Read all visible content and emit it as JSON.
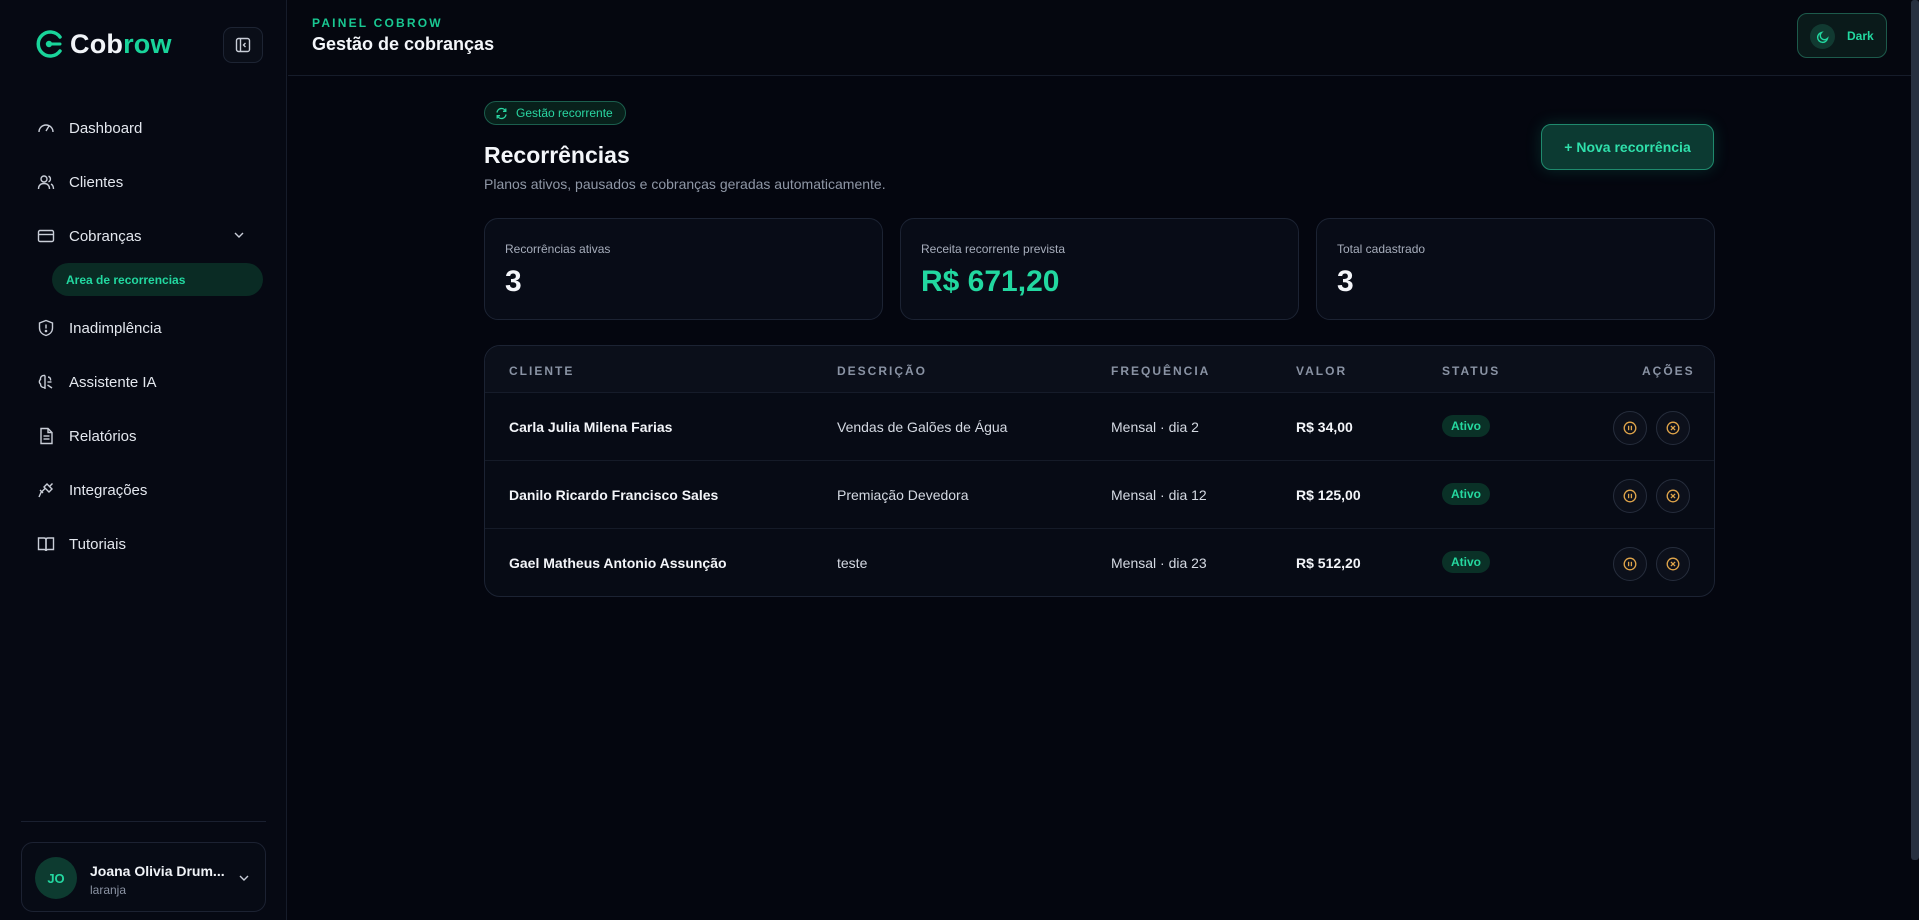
{
  "brand": {
    "name_part1": "Cob",
    "name_part2": "row",
    "accent": "#19d49a"
  },
  "sidebar": {
    "items": [
      {
        "label": "Dashboard",
        "icon": "gauge-icon"
      },
      {
        "label": "Clientes",
        "icon": "users-icon"
      },
      {
        "label": "Cobranças",
        "icon": "credit-card-icon",
        "expanded": true
      },
      {
        "label": "Inadimplência",
        "icon": "shield-alert-icon"
      },
      {
        "label": "Assistente IA",
        "icon": "brain-icon"
      },
      {
        "label": "Relatórios",
        "icon": "file-text-icon"
      },
      {
        "label": "Integrações",
        "icon": "plug-icon"
      },
      {
        "label": "Tutoriais",
        "icon": "book-open-icon"
      }
    ],
    "sub_item": "Area de recorrencias",
    "user": {
      "initials": "JO",
      "name": "Joana Olivia Drum...",
      "subtitle": "laranja"
    }
  },
  "header": {
    "kicker": "PAINEL COBROW",
    "title": "Gestão de cobranças",
    "theme_label": "Dark"
  },
  "main": {
    "pill": "Gestão recorrente",
    "title": "Recorrências",
    "subtitle": "Planos ativos, pausados e cobranças geradas automaticamente.",
    "new_button": "+ Nova recorrência",
    "stats": [
      {
        "label": "Recorrências ativas",
        "value": "3"
      },
      {
        "label": "Receita recorrente prevista",
        "value": "R$ 671,20"
      },
      {
        "label": "Total cadastrado",
        "value": "3"
      }
    ],
    "table": {
      "columns": [
        "CLIENTE",
        "DESCRIÇÃO",
        "FREQUÊNCIA",
        "VALOR",
        "STATUS",
        "AÇÕES"
      ],
      "rows": [
        {
          "client": "Carla Julia Milena Farias",
          "description": "Vendas de Galões de Água",
          "frequency": "Mensal · dia 2",
          "value": "R$ 34,00",
          "status": "Ativo"
        },
        {
          "client": "Danilo Ricardo Francisco Sales",
          "description": "Premiação Devedora",
          "frequency": "Mensal · dia 12",
          "value": "R$ 125,00",
          "status": "Ativo"
        },
        {
          "client": "Gael Matheus Antonio Assunção",
          "description": "teste",
          "frequency": "Mensal · dia 23",
          "value": "R$ 512,20",
          "status": "Ativo"
        }
      ]
    }
  }
}
